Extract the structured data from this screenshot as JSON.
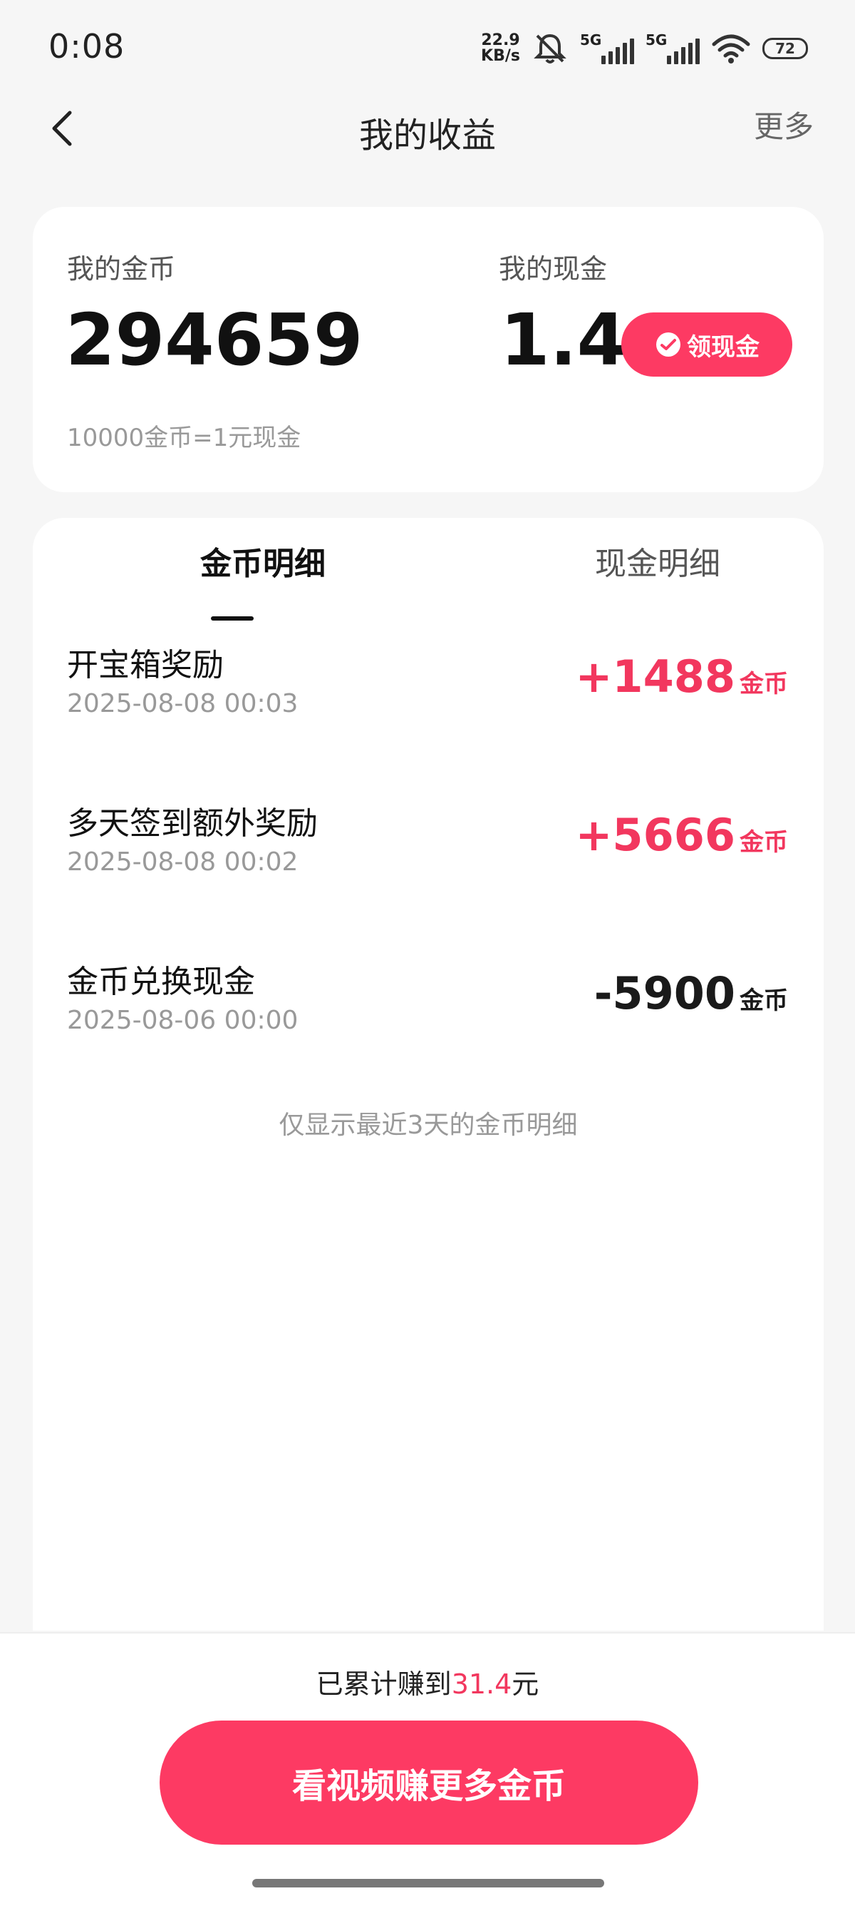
{
  "status_bar": {
    "time": "0:08",
    "net_speed_value": "22.9",
    "net_speed_unit": "KB/s",
    "sim1_label": "5G",
    "sim2_label": "5G",
    "battery": "72",
    "icons": [
      "mute-bell-icon",
      "signal-icon",
      "wifi-icon",
      "battery-icon"
    ]
  },
  "nav": {
    "title": "我的收益",
    "more": "更多",
    "back_icon": "chevron-left-icon"
  },
  "summary": {
    "coins_label": "我的金币",
    "coins_value": "294659",
    "cash_label": "我的现金",
    "cash_value": "1.4",
    "withdraw_label": "领现金",
    "withdraw_icon": "checkmark-badge-icon",
    "rate_note": "10000金币=1元现金"
  },
  "tabs": [
    {
      "label": "金币明细",
      "active": true
    },
    {
      "label": "现金明细",
      "active": false
    }
  ],
  "records": [
    {
      "title": "开宝箱奖励",
      "time": "2025-08-08 00:03",
      "amount": "+1488",
      "unit": "金币"
    },
    {
      "title": "多天签到额外奖励",
      "time": "2025-08-08 00:02",
      "amount": "+5666",
      "unit": "金币"
    },
    {
      "title": "金币兑换现金",
      "time": "2025-08-06 00:00",
      "amount": "-5900",
      "unit": "金币"
    }
  ],
  "recent_note": "仅显示最近3天的金币明细",
  "bottom": {
    "earned_prefix": "已累计赚到",
    "earned_value": "31.4",
    "earned_suffix": "元",
    "cta": "看视频赚更多金币"
  },
  "colors": {
    "accent": "#fd3a63",
    "positive_amount": "#f2375e",
    "background": "#f6f6f6"
  }
}
